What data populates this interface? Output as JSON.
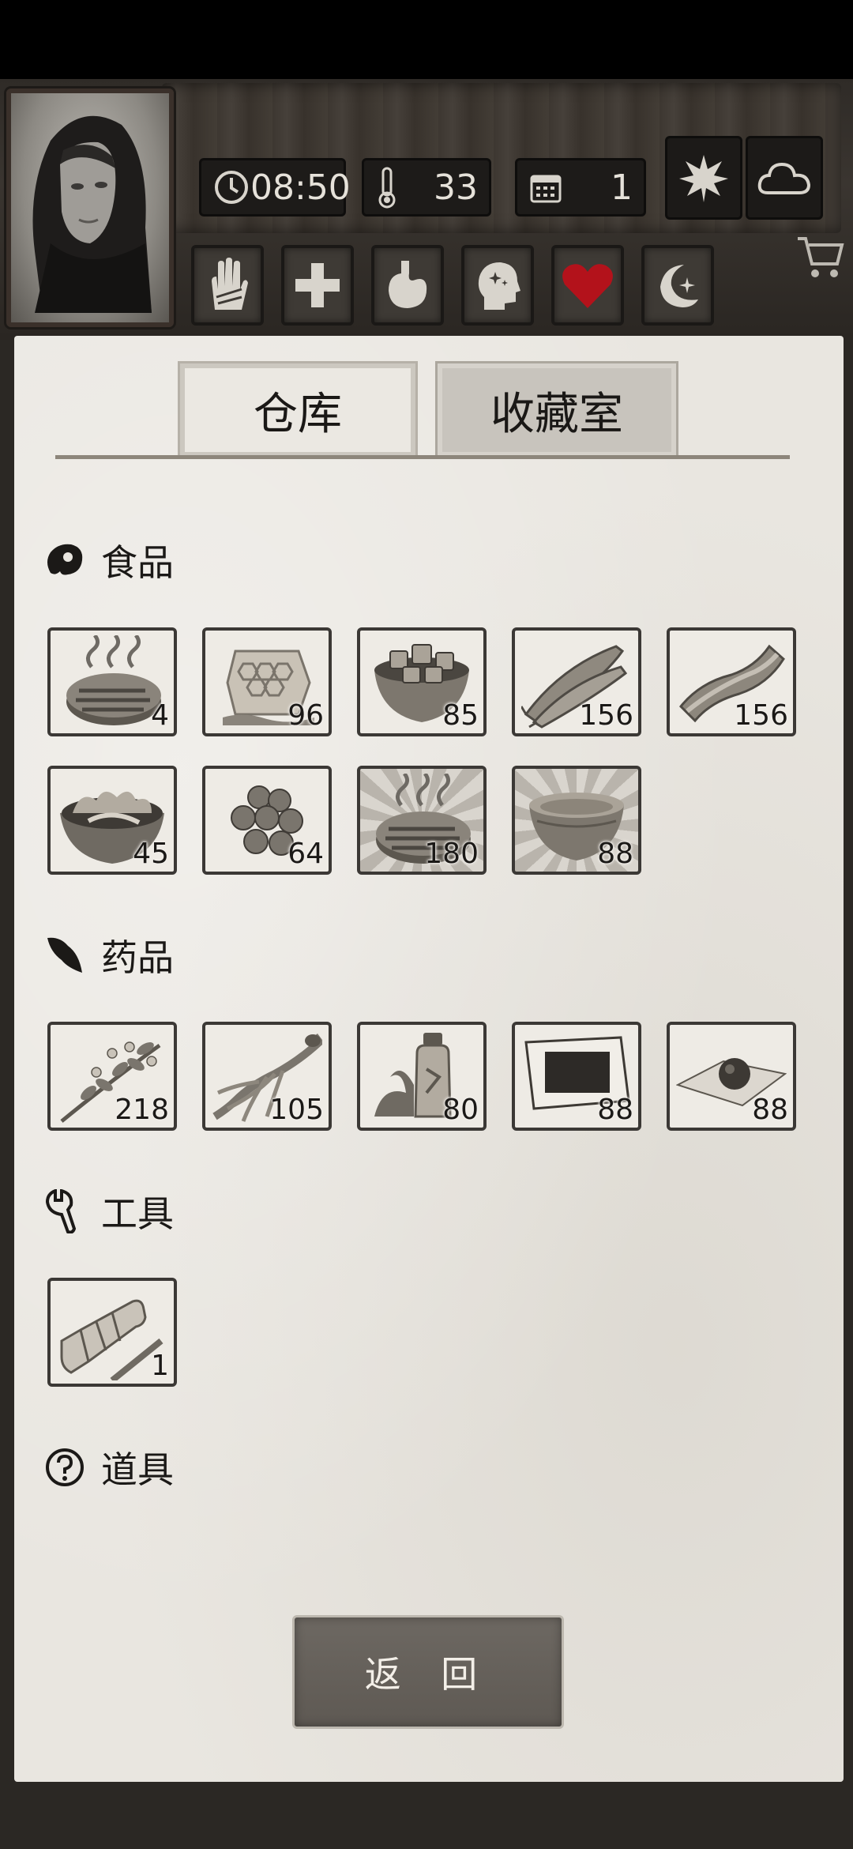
{
  "hud": {
    "time": "08:50",
    "temperature": "33",
    "day": "1",
    "season_icon": "leaf-icon",
    "weather_icon": "cloud-icon",
    "conditions": [
      "hand-icon",
      "health-cross-icon",
      "stomach-icon",
      "mind-icon",
      "heart-icon",
      "sleep-moon-icon"
    ],
    "heart_color": "#b3121b"
  },
  "tabs": {
    "storage": "仓库",
    "collection": "收藏室"
  },
  "categories": {
    "food": "食品",
    "medicine": "药品",
    "tools": "工具",
    "props": "道具"
  },
  "food_items": [
    {
      "icon": "grilled-meat-icon",
      "count": "4"
    },
    {
      "icon": "honeycomb-icon",
      "count": "96"
    },
    {
      "icon": "meat-cubes-bowl-icon",
      "count": "85"
    },
    {
      "icon": "dried-fish-icon",
      "count": "156"
    },
    {
      "icon": "bacon-icon",
      "count": "156"
    },
    {
      "icon": "salad-bowl-icon",
      "count": "45"
    },
    {
      "icon": "meatballs-icon",
      "count": "64"
    },
    {
      "icon": "grilled-meat-icon",
      "count": "180"
    },
    {
      "icon": "soup-bowl-icon",
      "count": "88"
    }
  ],
  "medicine_items": [
    {
      "icon": "herb-branch-icon",
      "count": "218"
    },
    {
      "icon": "ginseng-root-icon",
      "count": "105"
    },
    {
      "icon": "tonic-bottle-icon",
      "count": "80"
    },
    {
      "icon": "medicinal-plaster-icon",
      "count": "88"
    },
    {
      "icon": "pill-on-paper-icon",
      "count": "88"
    }
  ],
  "tool_items": [
    {
      "icon": "flashlight-icon",
      "count": "1"
    }
  ],
  "back_button": "返 回"
}
